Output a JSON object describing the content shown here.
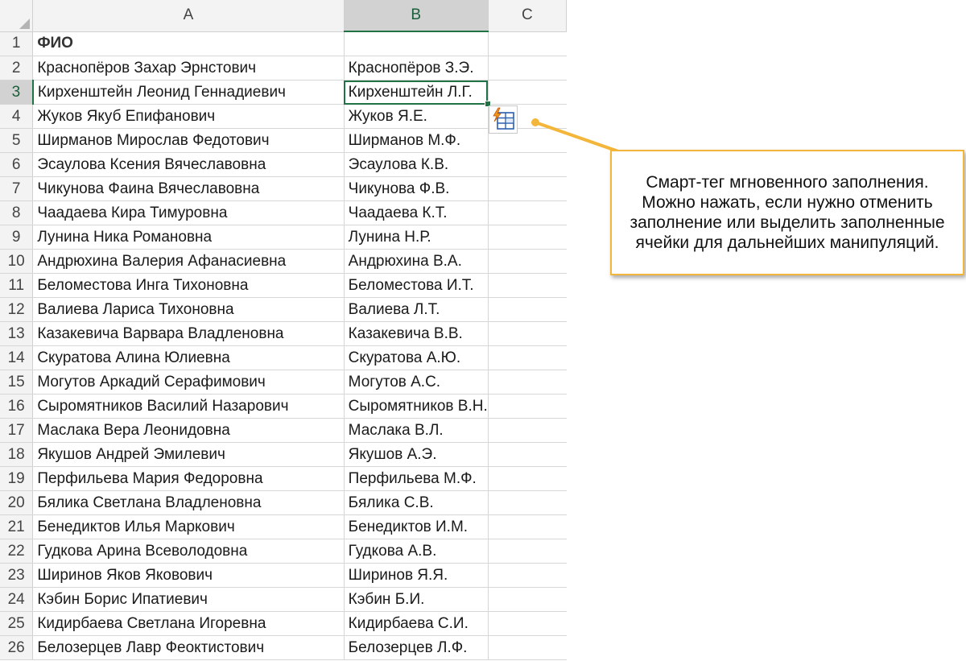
{
  "columns": [
    "A",
    "B",
    "C"
  ],
  "selected_cell": "B3",
  "rows": [
    {
      "num": "1",
      "a": "ФИО",
      "b": ""
    },
    {
      "num": "2",
      "a": "Краснопёров Захар Эрнстович",
      "b": "Краснопёров З.Э."
    },
    {
      "num": "3",
      "a": "Кирхенштейн Леонид Геннадиевич",
      "b": "Кирхенштейн Л.Г."
    },
    {
      "num": "4",
      "a": "Жуков Якуб Епифанович",
      "b": "Жуков Я.Е."
    },
    {
      "num": "5",
      "a": "Ширманов Мирослав Федотович",
      "b": "Ширманов М.Ф."
    },
    {
      "num": "6",
      "a": "Эсаулова Ксения Вячеславовна",
      "b": "Эсаулова К.В."
    },
    {
      "num": "7",
      "a": "Чикунова Фаина Вячеславовна",
      "b": "Чикунова Ф.В."
    },
    {
      "num": "8",
      "a": "Чаадаева Кира Тимуровна",
      "b": "Чаадаева К.Т."
    },
    {
      "num": "9",
      "a": "Лунина Ника Романовна",
      "b": "Лунина Н.Р."
    },
    {
      "num": "10",
      "a": "Андрюхина Валерия Афанасиевна",
      "b": "Андрюхина В.А."
    },
    {
      "num": "11",
      "a": "Беломестова Инга Тихоновна",
      "b": "Беломестова И.Т."
    },
    {
      "num": "12",
      "a": "Валиева Лариса Тихоновна",
      "b": "Валиева Л.Т."
    },
    {
      "num": "13",
      "a": "Казакевича Варвара Владленовна",
      "b": "Казакевича В.В."
    },
    {
      "num": "14",
      "a": "Скуратова Алина Юлиевна",
      "b": "Скуратова А.Ю."
    },
    {
      "num": "15",
      "a": "Могутов Аркадий Серафимович",
      "b": "Могутов А.С."
    },
    {
      "num": "16",
      "a": "Сыромятников Василий Назарович",
      "b": "Сыромятников В.Н."
    },
    {
      "num": "17",
      "a": "Маслака Вера Леонидовна",
      "b": "Маслака В.Л."
    },
    {
      "num": "18",
      "a": "Якушов Андрей Эмилевич",
      "b": "Якушов А.Э."
    },
    {
      "num": "19",
      "a": "Перфильева Мария Федоровна",
      "b": "Перфильева М.Ф."
    },
    {
      "num": "20",
      "a": "Бялика Светлана Владленовна",
      "b": "Бялика С.В."
    },
    {
      "num": "21",
      "a": "Бенедиктов Илья Маркович",
      "b": "Бенедиктов И.М."
    },
    {
      "num": "22",
      "a": "Гудкова Арина Всеволодовна",
      "b": "Гудкова А.В."
    },
    {
      "num": "23",
      "a": "Ширинов Яков Яковович",
      "b": "Ширинов Я.Я."
    },
    {
      "num": "24",
      "a": "Кэбин Борис Ипатиевич",
      "b": "Кэбин Б.И."
    },
    {
      "num": "25",
      "a": "Кидирбаева Светлана Игоревна",
      "b": "Кидирбаева С.И."
    },
    {
      "num": "26",
      "a": "Белозерцев Лавр Феоктистович",
      "b": "Белозерцев Л.Ф."
    }
  ],
  "smart_tag": {
    "icon": "flash-fill-icon"
  },
  "callout": {
    "text": "Смарт-тег мгновенного заполнения. Можно нажать, если нужно отменить заполнение или выделить заполненные ячейки для дальнейших манипуляций.",
    "border_color": "#f4b63a"
  },
  "colors": {
    "accent": "#217346",
    "callout_border": "#f4b63a"
  }
}
